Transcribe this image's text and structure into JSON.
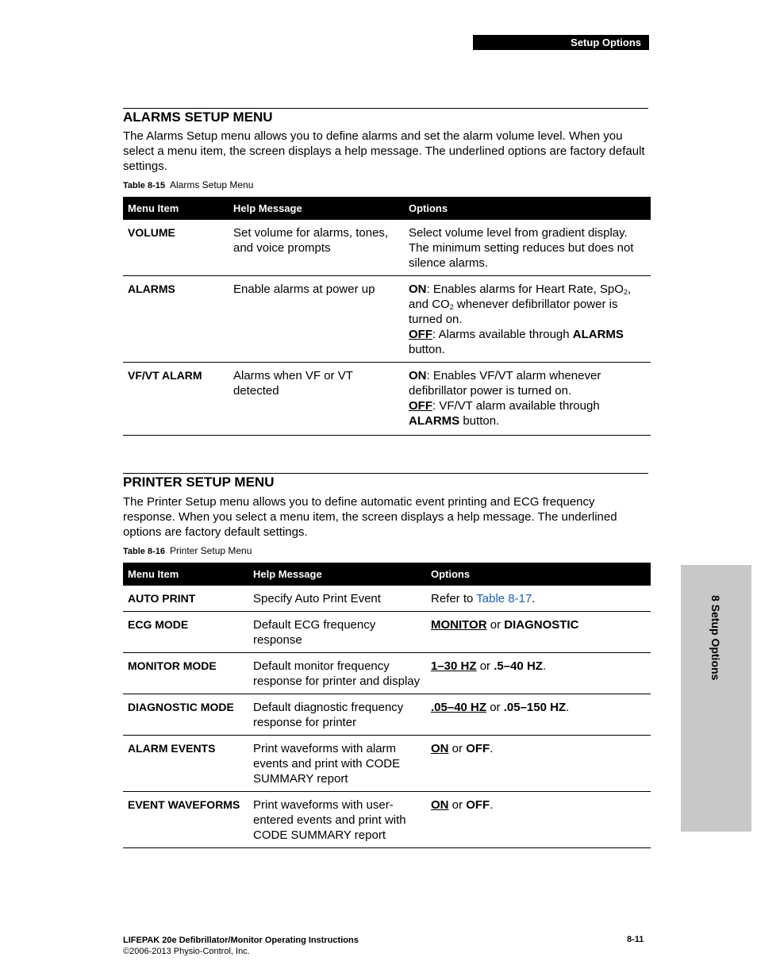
{
  "header": {
    "section_tab": "Setup Options"
  },
  "side_tab": {
    "label": "8 Setup Options"
  },
  "alarms": {
    "title": "ALARMS SETUP MENU",
    "intro": "The Alarms Setup menu allows you to define alarms and set the alarm volume level. When you select a menu item, the screen displays a help message. The underlined options are factory default settings.",
    "caption_num": "Table 8-15",
    "caption_text": "Alarms Setup Menu",
    "columns": [
      "Menu Item",
      "Help Message",
      "Options"
    ],
    "rows": [
      {
        "item": "VOLUME",
        "help": "Set volume for alarms, tones, and voice prompts",
        "options": "Select volume level from gradient display. The minimum setting reduces but does not silence alarms."
      },
      {
        "item": "ALARMS",
        "help": "Enable alarms at power up",
        "on_label": "ON",
        "on_text_a": ": Enables alarms for Heart Rate, SpO",
        "sub1": "2",
        "on_text_b": ", and CO",
        "sub2": "2",
        "on_text_c": " whenever defibrillator power is turned on.",
        "off_label": "OFF",
        "off_text_a": ": Alarms available through ",
        "off_bold": "ALARMS",
        "off_text_b": " button."
      },
      {
        "item": "VF/VT ALARM",
        "help": "Alarms when VF or VT detected",
        "on_label": "ON",
        "on_text": ": Enables VF/VT alarm whenever defibrillator power is turned on.",
        "off_label": "OFF",
        "off_text_a": ": VF/VT alarm available through ",
        "off_bold": "ALARMS",
        "off_text_b": " button."
      }
    ]
  },
  "printer": {
    "title": "PRINTER SETUP MENU",
    "intro": "The Printer Setup menu allows you to define automatic event printing and ECG frequency response. When you select a menu item, the screen displays a help message. The underlined options are factory default settings.",
    "caption_num": "Table 8-16",
    "caption_text": "Printer Setup Menu",
    "columns": [
      "Menu Item",
      "Help Message",
      "Options"
    ],
    "rows": [
      {
        "item": "AUTO PRINT",
        "help": "Specify Auto Print Event",
        "opt_pre": "Refer to ",
        "opt_link": "Table 8-17",
        "opt_post": "."
      },
      {
        "item": "ECG MODE",
        "help": "Default ECG frequency response",
        "default": "MONITOR",
        "or": " or ",
        "alt": "DIAGNOSTIC",
        "end": ""
      },
      {
        "item": "MONITOR MODE",
        "help": "Default monitor frequency response for printer and display",
        "default": "1–30 HZ",
        "or": " or ",
        "alt": ".5–40 HZ",
        "end": "."
      },
      {
        "item": "DIAGNOSTIC MODE",
        "help": "Default diagnostic frequency response for printer",
        "default": ".05–40 HZ",
        "or": " or ",
        "alt": ".05–150 HZ",
        "end": "."
      },
      {
        "item": "ALARM EVENTS",
        "help": "Print waveforms with alarm events and print with CODE SUMMARY report",
        "default": "ON",
        "or": " or ",
        "alt": "OFF",
        "end": "."
      },
      {
        "item": "EVENT WAVEFORMS",
        "help": "Print waveforms with user-entered events and print with CODE SUMMARY report",
        "default": "ON",
        "or": " or ",
        "alt": "OFF",
        "end": "."
      }
    ]
  },
  "footer": {
    "title": "LIFEPAK 20e Defibrillator/Monitor Operating Instructions",
    "copyright": "©2006-2013 Physio-Control, Inc.",
    "page": "8-11"
  }
}
